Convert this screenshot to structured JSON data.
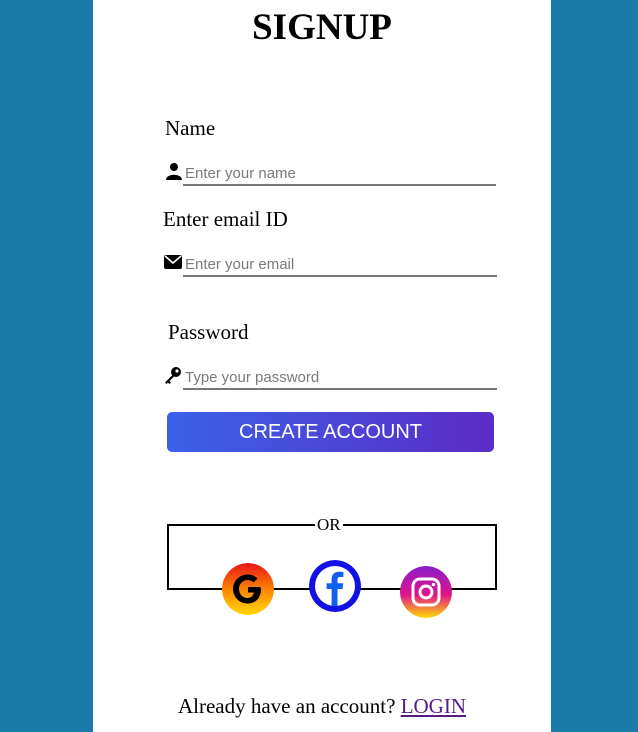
{
  "form": {
    "title": "SIGNUP",
    "name_label": "Name",
    "name_placeholder": "Enter your name",
    "email_label": "Enter email ID",
    "email_placeholder": "Enter your email",
    "password_label": "Password",
    "password_placeholder": "Type your password",
    "submit_label": "CREATE ACCOUNT"
  },
  "divider": {
    "text": "OR"
  },
  "social": [
    {
      "icon": "google-icon"
    },
    {
      "icon": "facebook-icon"
    },
    {
      "icon": "instagram-icon"
    }
  ],
  "footer": {
    "prompt": "Already have an account?",
    "login_label": "LOGIN"
  },
  "colors": {
    "background": "#1a7bab",
    "button_start": "#3a62e8",
    "button_end": "#5b2bc7",
    "facebook": "#1260f0",
    "link": "#551a8b"
  }
}
